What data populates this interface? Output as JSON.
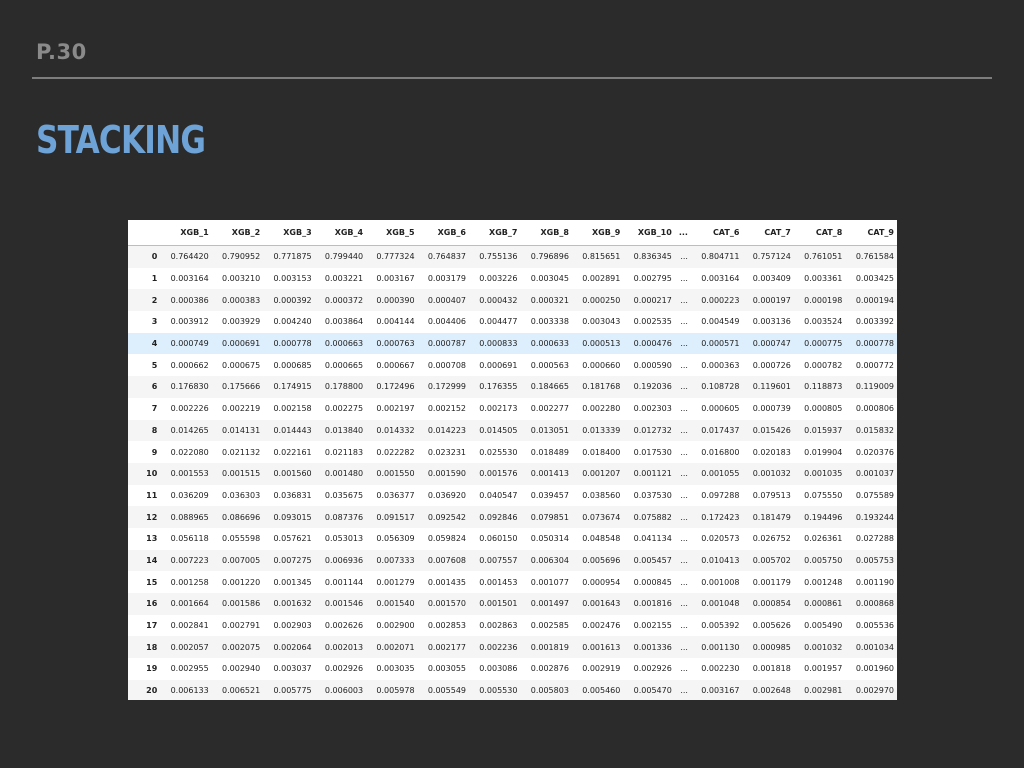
{
  "slide": {
    "page_number": "P.30",
    "title": "STACKING"
  },
  "table": {
    "highlighted_row": 4,
    "columns": [
      "XGB_1",
      "XGB_2",
      "XGB_3",
      "XGB_4",
      "XGB_5",
      "XGB_6",
      "XGB_7",
      "XGB_8",
      "XGB_9",
      "XGB_10",
      "...",
      "CAT_6",
      "CAT_7",
      "CAT_8",
      "CAT_9"
    ],
    "rows": [
      {
        "index": "0",
        "cells": [
          "0.764420",
          "0.790952",
          "0.771875",
          "0.799440",
          "0.777324",
          "0.764837",
          "0.755136",
          "0.796896",
          "0.815651",
          "0.836345",
          "...",
          "0.804711",
          "0.757124",
          "0.761051",
          "0.761584"
        ]
      },
      {
        "index": "1",
        "cells": [
          "0.003164",
          "0.003210",
          "0.003153",
          "0.003221",
          "0.003167",
          "0.003179",
          "0.003226",
          "0.003045",
          "0.002891",
          "0.002795",
          "...",
          "0.003164",
          "0.003409",
          "0.003361",
          "0.003425"
        ]
      },
      {
        "index": "2",
        "cells": [
          "0.000386",
          "0.000383",
          "0.000392",
          "0.000372",
          "0.000390",
          "0.000407",
          "0.000432",
          "0.000321",
          "0.000250",
          "0.000217",
          "...",
          "0.000223",
          "0.000197",
          "0.000198",
          "0.000194"
        ]
      },
      {
        "index": "3",
        "cells": [
          "0.003912",
          "0.003929",
          "0.004240",
          "0.003864",
          "0.004144",
          "0.004406",
          "0.004477",
          "0.003338",
          "0.003043",
          "0.002535",
          "...",
          "0.004549",
          "0.003136",
          "0.003524",
          "0.003392"
        ]
      },
      {
        "index": "4",
        "cells": [
          "0.000749",
          "0.000691",
          "0.000778",
          "0.000663",
          "0.000763",
          "0.000787",
          "0.000833",
          "0.000633",
          "0.000513",
          "0.000476",
          "...",
          "0.000571",
          "0.000747",
          "0.000775",
          "0.000778"
        ]
      },
      {
        "index": "5",
        "cells": [
          "0.000662",
          "0.000675",
          "0.000685",
          "0.000665",
          "0.000667",
          "0.000708",
          "0.000691",
          "0.000563",
          "0.000660",
          "0.000590",
          "...",
          "0.000363",
          "0.000726",
          "0.000782",
          "0.000772"
        ]
      },
      {
        "index": "6",
        "cells": [
          "0.176830",
          "0.175666",
          "0.174915",
          "0.178800",
          "0.172496",
          "0.172999",
          "0.176355",
          "0.184665",
          "0.181768",
          "0.192036",
          "...",
          "0.108728",
          "0.119601",
          "0.118873",
          "0.119009"
        ]
      },
      {
        "index": "7",
        "cells": [
          "0.002226",
          "0.002219",
          "0.002158",
          "0.002275",
          "0.002197",
          "0.002152",
          "0.002173",
          "0.002277",
          "0.002280",
          "0.002303",
          "...",
          "0.000605",
          "0.000739",
          "0.000805",
          "0.000806"
        ]
      },
      {
        "index": "8",
        "cells": [
          "0.014265",
          "0.014131",
          "0.014443",
          "0.013840",
          "0.014332",
          "0.014223",
          "0.014505",
          "0.013051",
          "0.013339",
          "0.012732",
          "...",
          "0.017437",
          "0.015426",
          "0.015937",
          "0.015832"
        ]
      },
      {
        "index": "9",
        "cells": [
          "0.022080",
          "0.021132",
          "0.022161",
          "0.021183",
          "0.022282",
          "0.023231",
          "0.025530",
          "0.018489",
          "0.018400",
          "0.017530",
          "...",
          "0.016800",
          "0.020183",
          "0.019904",
          "0.020376"
        ]
      },
      {
        "index": "10",
        "cells": [
          "0.001553",
          "0.001515",
          "0.001560",
          "0.001480",
          "0.001550",
          "0.001590",
          "0.001576",
          "0.001413",
          "0.001207",
          "0.001121",
          "...",
          "0.001055",
          "0.001032",
          "0.001035",
          "0.001037"
        ]
      },
      {
        "index": "11",
        "cells": [
          "0.036209",
          "0.036303",
          "0.036831",
          "0.035675",
          "0.036377",
          "0.036920",
          "0.040547",
          "0.039457",
          "0.038560",
          "0.037530",
          "...",
          "0.097288",
          "0.079513",
          "0.075550",
          "0.075589"
        ]
      },
      {
        "index": "12",
        "cells": [
          "0.088965",
          "0.086696",
          "0.093015",
          "0.087376",
          "0.091517",
          "0.092542",
          "0.092846",
          "0.079851",
          "0.073674",
          "0.075882",
          "...",
          "0.172423",
          "0.181479",
          "0.194496",
          "0.193244"
        ]
      },
      {
        "index": "13",
        "cells": [
          "0.056118",
          "0.055598",
          "0.057621",
          "0.053013",
          "0.056309",
          "0.059824",
          "0.060150",
          "0.050314",
          "0.048548",
          "0.041134",
          "...",
          "0.020573",
          "0.026752",
          "0.026361",
          "0.027288"
        ]
      },
      {
        "index": "14",
        "cells": [
          "0.007223",
          "0.007005",
          "0.007275",
          "0.006936",
          "0.007333",
          "0.007608",
          "0.007557",
          "0.006304",
          "0.005696",
          "0.005457",
          "...",
          "0.010413",
          "0.005702",
          "0.005750",
          "0.005753"
        ]
      },
      {
        "index": "15",
        "cells": [
          "0.001258",
          "0.001220",
          "0.001345",
          "0.001144",
          "0.001279",
          "0.001435",
          "0.001453",
          "0.001077",
          "0.000954",
          "0.000845",
          "...",
          "0.001008",
          "0.001179",
          "0.001248",
          "0.001190"
        ]
      },
      {
        "index": "16",
        "cells": [
          "0.001664",
          "0.001586",
          "0.001632",
          "0.001546",
          "0.001540",
          "0.001570",
          "0.001501",
          "0.001497",
          "0.001643",
          "0.001816",
          "...",
          "0.001048",
          "0.000854",
          "0.000861",
          "0.000868"
        ]
      },
      {
        "index": "17",
        "cells": [
          "0.002841",
          "0.002791",
          "0.002903",
          "0.002626",
          "0.002900",
          "0.002853",
          "0.002863",
          "0.002585",
          "0.002476",
          "0.002155",
          "...",
          "0.005392",
          "0.005626",
          "0.005490",
          "0.005536"
        ]
      },
      {
        "index": "18",
        "cells": [
          "0.002057",
          "0.002075",
          "0.002064",
          "0.002013",
          "0.002071",
          "0.002177",
          "0.002236",
          "0.001819",
          "0.001613",
          "0.001336",
          "...",
          "0.001130",
          "0.000985",
          "0.001032",
          "0.001034"
        ]
      },
      {
        "index": "19",
        "cells": [
          "0.002955",
          "0.002940",
          "0.003037",
          "0.002926",
          "0.003035",
          "0.003055",
          "0.003086",
          "0.002876",
          "0.002919",
          "0.002926",
          "...",
          "0.002230",
          "0.001818",
          "0.001957",
          "0.001960"
        ]
      },
      {
        "index": "20",
        "cells": [
          "0.006133",
          "0.006521",
          "0.005775",
          "0.006003",
          "0.005978",
          "0.005549",
          "0.005530",
          "0.005803",
          "0.005460",
          "0.005470",
          "...",
          "0.003167",
          "0.002648",
          "0.002981",
          "0.002970"
        ]
      }
    ]
  }
}
